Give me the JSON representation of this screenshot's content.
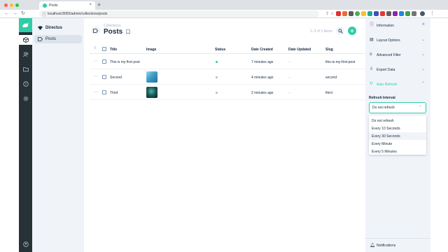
{
  "browser": {
    "tab_title": "Posts",
    "tab_close": "×",
    "new_tab": "+",
    "url": "localhost:8055/admin/collections/posts",
    "back": "←",
    "forward": "→",
    "reload": "↻"
  },
  "leftpane": {
    "project_name": "Directus",
    "items": [
      {
        "label": "Posts"
      }
    ]
  },
  "header": {
    "breadcrumb": "Collections",
    "title": "Posts",
    "item_count": "1–3 of 3 Items",
    "add": "+"
  },
  "table": {
    "columns": [
      "Title",
      "Image",
      "Status",
      "Date Created",
      "Date Updated",
      "Slug"
    ],
    "rows": [
      {
        "title": "This is my first post",
        "image": "",
        "status_color": "#2ecda7",
        "date_created": "7 minutes ago",
        "date_updated": "--",
        "slug": "this-is-my-first-post"
      },
      {
        "title": "Second",
        "image": "ocean",
        "status_color": "#b0bec5",
        "date_created": "4 minutes ago",
        "date_updated": "--",
        "slug": "second"
      },
      {
        "title": "Third",
        "image": "ocean",
        "status_color": "#b0bec5",
        "date_created": "2 minutes ago",
        "date_updated": "--",
        "slug": "third"
      }
    ]
  },
  "sidebar": {
    "sections": [
      {
        "label": "Information",
        "icon": "info-icon",
        "control": "×"
      },
      {
        "label": "Layout Options",
        "icon": "layout-icon",
        "control": "⌄"
      },
      {
        "label": "Advanced Filter",
        "icon": "filter-icon",
        "control": "⌄"
      },
      {
        "label": "Export Data",
        "icon": "export-icon",
        "control": "⌄"
      },
      {
        "label": "Auto Refresh",
        "icon": "refresh-icon",
        "control": "⌃",
        "active": true
      }
    ],
    "refresh_label": "Refresh Interval",
    "refresh_value": "Do not refresh",
    "refresh_options": [
      "Do not refresh",
      "Every 10 Seconds",
      "Every 30 Seconds",
      "Every Minute",
      "Every 5 Minutes"
    ],
    "notifications": "Notifications"
  },
  "colors": {
    "accent": "#2ecda7",
    "navbar": "#263238",
    "pane": "#f0f4f9"
  }
}
